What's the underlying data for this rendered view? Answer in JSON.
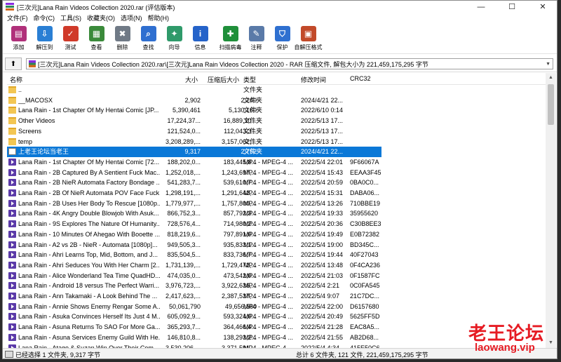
{
  "window": {
    "title": "[三次元]Lana Rain Videos Collection 2020.rar (评估版本)",
    "minimize": "—",
    "maximize": "☐",
    "close": "✕"
  },
  "menu": [
    "文件(F)",
    "命令(C)",
    "工具(S)",
    "收藏夹(O)",
    "选项(N)",
    "帮助(H)"
  ],
  "toolbar": [
    {
      "label": "添加",
      "icon": "add-archive-icon",
      "color": "#b0307a"
    },
    {
      "label": "解压到",
      "icon": "extract-to-icon",
      "color": "#2a7fd4"
    },
    {
      "label": "测试",
      "icon": "test-icon",
      "color": "#d03a2a"
    },
    {
      "label": "查看",
      "icon": "view-icon",
      "color": "#3a8a3a"
    },
    {
      "label": "删除",
      "icon": "delete-icon",
      "color": "#707a86"
    },
    {
      "label": "查找",
      "icon": "find-icon",
      "color": "#2f6fd0"
    },
    {
      "label": "向导",
      "icon": "wizard-icon",
      "color": "#2f9a6a"
    },
    {
      "label": "信息",
      "icon": "info-icon",
      "color": "#2563c9"
    },
    {
      "label": "扫描病毒",
      "icon": "virus-scan-icon",
      "color": "#1f8f3a"
    },
    {
      "label": "注释",
      "icon": "comment-icon",
      "color": "#5a7aa8"
    },
    {
      "label": "保护",
      "icon": "protect-icon",
      "color": "#2f70d0"
    },
    {
      "label": "自解压格式",
      "icon": "sfx-icon",
      "color": "#c24a2a"
    }
  ],
  "address": {
    "path": "[三次元]Lana Rain Videos Collection 2020.rar\\[三次元]Lana Rain Videos Collection 2020 - RAR 压缩文件, 解包大小为 221,459,175,295 字节"
  },
  "columns": {
    "name": "名称",
    "size": "大小",
    "packed": "压缩后大小",
    "type": "类型",
    "modified": "修改时间",
    "crc": "CRC32"
  },
  "files": [
    {
      "name": "..",
      "size": "",
      "packed": "",
      "type": "文件夹",
      "modified": "",
      "crc": "",
      "kind": "folder"
    },
    {
      "name": "__MACOSX",
      "size": "2,902",
      "packed": "2,240",
      "type": "文件夹",
      "modified": "2024/4/21 22...",
      "crc": "",
      "kind": "folder"
    },
    {
      "name": "Lana Rain - 1st Chapter Of My Hentai Comic [JP...",
      "size": "5,390,461",
      "packed": "5,130,160",
      "type": "文件夹",
      "modified": "2022/6/10 0:14",
      "crc": "",
      "kind": "folder"
    },
    {
      "name": "Other Videos",
      "size": "17,224,37...",
      "packed": "16,889,10...",
      "type": "文件夹",
      "modified": "2022/5/13 17...",
      "crc": "",
      "kind": "folder"
    },
    {
      "name": "Screens",
      "size": "121,524,0...",
      "packed": "112,043,3...",
      "type": "文件夹",
      "modified": "2022/5/13 17...",
      "crc": "",
      "kind": "folder"
    },
    {
      "name": "temp",
      "size": "3,208,289,...",
      "packed": "3,157,062,...",
      "type": "文件夹",
      "modified": "2022/5/13 17...",
      "crc": "",
      "kind": "folder"
    },
    {
      "name": "上老王论坛当老王",
      "size": "9,317",
      "packed": "2,752",
      "type": "文件夹",
      "modified": "2024/4/21 22...",
      "crc": "",
      "kind": "folder",
      "selected": true
    },
    {
      "name": "Lana Rain - 1st Chapter Of My Hentai Comic [72...",
      "size": "188,202,0...",
      "packed": "183,445,8...",
      "type": "MP4 - MPEG-4 ...",
      "modified": "2022/5/4 22:01",
      "crc": "9F66067A",
      "kind": "video"
    },
    {
      "name": "Lana Rain - 2B Captured By A Sentient Fuck Mac...",
      "size": "1,252,018,...",
      "packed": "1,243,697,...",
      "type": "MP4 - MPEG-4 ...",
      "modified": "2022/5/4 15:43",
      "crc": "EEAA3F45",
      "kind": "video"
    },
    {
      "name": "Lana Rain - 2B NieR Automata Factory Bondage ...",
      "size": "541,283,7...",
      "packed": "539,610,7...",
      "type": "MP4 - MPEG-4 ...",
      "modified": "2022/5/4 20:59",
      "crc": "0BA0C0...",
      "kind": "video"
    },
    {
      "name": "Lana Rain - 2B Of NieR Automata POV Face Fuck...",
      "size": "1,298,191,...",
      "packed": "1,291,642,...",
      "type": "MP4 - MPEG-4 ...",
      "modified": "2022/5/4 15:31",
      "crc": "DABA06...",
      "kind": "video"
    },
    {
      "name": "Lana Rain - 2B Uses Her Body To Rescue [1080p...",
      "size": "1,779,977,...",
      "packed": "1,757,800,...",
      "type": "MP4 - MPEG-4 ...",
      "modified": "2022/5/4 13:26",
      "crc": "710BBE19",
      "kind": "video"
    },
    {
      "name": "Lana Rain - 4K Angry Double Blowjob With Asuk...",
      "size": "866,752,3...",
      "packed": "857,792,3...",
      "type": "MP4 - MPEG-4 ...",
      "modified": "2022/5/4 19:33",
      "crc": "35955620",
      "kind": "video"
    },
    {
      "name": "Lana Rain - 9S Explores The Nature Of Humanity...",
      "size": "728,576,4...",
      "packed": "714,980,2...",
      "type": "MP4 - MPEG-4 ...",
      "modified": "2022/5/4 20:36",
      "crc": "C30B8EE3",
      "kind": "video"
    },
    {
      "name": "Lana Rain - 10 Minutes Of Ahegao With Booette ...",
      "size": "818,219,6...",
      "packed": "797,891,0...",
      "type": "MP4 - MPEG-4 ...",
      "modified": "2022/5/4 19:49",
      "crc": "E0B72382",
      "kind": "video"
    },
    {
      "name": "Lana Rain - A2 vs 2B - NieR - Automata [1080p]...",
      "size": "949,505,3...",
      "packed": "935,833,1...",
      "type": "MP4 - MPEG-4 ...",
      "modified": "2022/5/4 19:00",
      "crc": "BD345C...",
      "kind": "video"
    },
    {
      "name": "Lana Rain - Ahri Learns Top, Mid, Bottom, and J...",
      "size": "835,504,5...",
      "packed": "833,736,7...",
      "type": "MP4 - MPEG-4 ...",
      "modified": "2022/5/4 19:44",
      "crc": "40F27043",
      "kind": "video"
    },
    {
      "name": "Lana Rain - Ahri Seduces You With Her Charm [2...",
      "size": "1,731,139,...",
      "packed": "1,729,472,...",
      "type": "MP4 - MPEG-4 ...",
      "modified": "2022/5/4 13:48",
      "crc": "0F4CA236",
      "kind": "video"
    },
    {
      "name": "Lana Rain - Alice Wonderland Tea Time QuadHD...",
      "size": "474,035,0...",
      "packed": "473,542,0...",
      "type": "MP4 - MPEG-4 ...",
      "modified": "2022/5/4 21:03",
      "crc": "0F1587FC",
      "kind": "video"
    },
    {
      "name": "Lana Rain - Android 18 versus The Perfect Warri...",
      "size": "3,976,723,...",
      "packed": "3,922,636,...",
      "type": "MP4 - MPEG-4 ...",
      "modified": "2022/5/4 2:21",
      "crc": "0C0FA545",
      "kind": "video"
    },
    {
      "name": "Lana Rain - Ann Takamaki - A Look Behind The ...",
      "size": "2,417,623,...",
      "packed": "2,387,537,...",
      "type": "MP4 - MPEG-4 ...",
      "modified": "2022/5/4 9:07",
      "crc": "21C7DC...",
      "kind": "video"
    },
    {
      "name": "Lana Rain - Annie Shows Enemy Rengar Some A...",
      "size": "50,061,790",
      "packed": "49,656,560",
      "type": "MP4 - MPEG-4 ...",
      "modified": "2022/5/4 22:00",
      "crc": "D6157680",
      "kind": "video"
    },
    {
      "name": "Lana Rain - Asuka Convinces Herself Its Just 4 M...",
      "size": "605,092,9...",
      "packed": "593,324,0...",
      "type": "MP4 - MPEG-4 ...",
      "modified": "2022/5/4 20:49",
      "crc": "5625FF5D",
      "kind": "video"
    },
    {
      "name": "Lana Rain - Asuna Returns To SAO For More Ga...",
      "size": "365,293,7...",
      "packed": "364,466,4...",
      "type": "MP4 - MPEG-4 ...",
      "modified": "2022/5/4 21:28",
      "crc": "EAC8A5...",
      "kind": "video"
    },
    {
      "name": "Lana Rain - Asuna Services Enemy Guild With He...",
      "size": "146,810,8...",
      "packed": "138,293,2...",
      "type": "MP4 - MPEG-4 ...",
      "modified": "2022/5/4 21:55",
      "crc": "AB2D68...",
      "kind": "video"
    },
    {
      "name": "Lana Rain - Atago & Suzan Win Over Their Com...",
      "size": "3,530,206,...",
      "packed": "3,371,591,...",
      "type": "MP4 - MPEG-4 ...",
      "modified": "2022/5/4 4:34",
      "crc": "415E50C6",
      "kind": "video"
    }
  ],
  "status": {
    "left": "已经选择 1 文件夹, 9,317 字节",
    "right": "总计 6 文件夹, 121 文件, 221,459,175,295 字节"
  },
  "watermark": {
    "cn": "老王论坛",
    "url": "laowang.vip",
    "color": "#e61b23"
  }
}
